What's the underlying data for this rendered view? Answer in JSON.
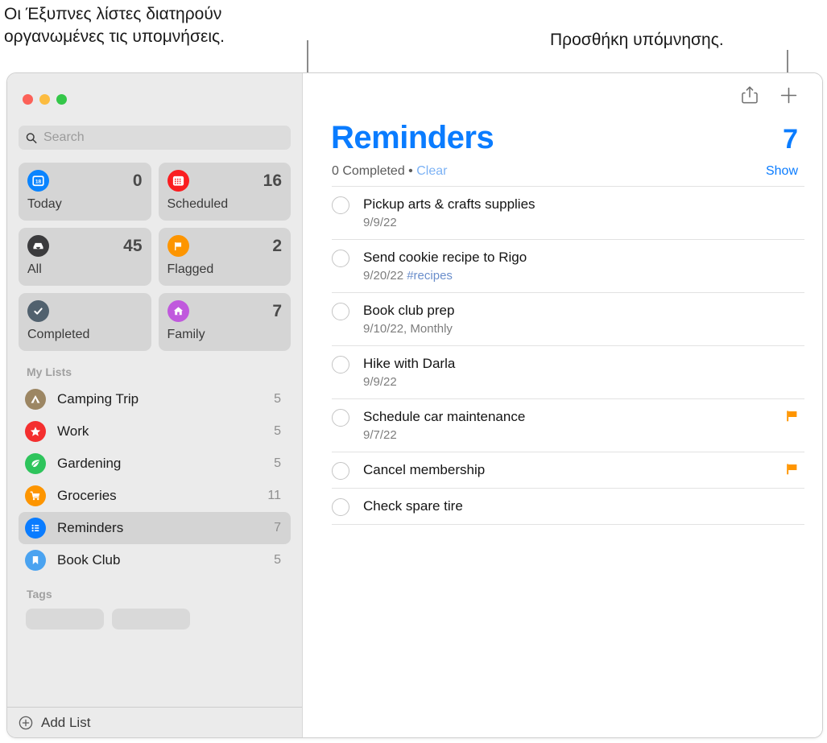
{
  "callouts": {
    "left": "Οι Έξυπνες λίστες διατηρούν\nοργανωμένες τις υπομνήσεις.",
    "right": "Προσθήκη υπόμνησης."
  },
  "window": {
    "traffic_lights": [
      {
        "name": "close",
        "color": "#fc6158"
      },
      {
        "name": "minimize",
        "color": "#fcbc40"
      },
      {
        "name": "zoom",
        "color": "#34c749"
      }
    ]
  },
  "sidebar": {
    "search": {
      "placeholder": "Search",
      "value": "",
      "icon": "search-icon"
    },
    "smart_lists": [
      {
        "label": "Today",
        "count": "0",
        "icon": "calendar-day-icon",
        "color": "#0a84ff"
      },
      {
        "label": "Scheduled",
        "count": "16",
        "icon": "calendar-grid-icon",
        "color": "#fa1d20"
      },
      {
        "label": "All",
        "count": "45",
        "icon": "inbox-tray-icon",
        "color": "#3b3b3d"
      },
      {
        "label": "Flagged",
        "count": "2",
        "icon": "flag-icon",
        "color": "#fd9500"
      },
      {
        "label": "Completed",
        "count": "",
        "icon": "checkmark-icon",
        "color": "#51616e"
      },
      {
        "label": "Family",
        "count": "7",
        "icon": "house-icon",
        "color": "#c059dd"
      }
    ],
    "my_lists_header": "My Lists",
    "lists": [
      {
        "label": "Camping Trip",
        "count": "5",
        "icon": "tent-icon",
        "color": "#9c8663",
        "selected": false
      },
      {
        "label": "Work",
        "count": "5",
        "icon": "star-icon",
        "color": "#f42f2f",
        "selected": false
      },
      {
        "label": "Gardening",
        "count": "5",
        "icon": "leaf-icon",
        "color": "#2ec45c",
        "selected": false
      },
      {
        "label": "Groceries",
        "count": "11",
        "icon": "cart-icon",
        "color": "#fd9500",
        "selected": false
      },
      {
        "label": "Reminders",
        "count": "7",
        "icon": "bullet-list-icon",
        "color": "#0a7cff",
        "selected": true
      },
      {
        "label": "Book Club",
        "count": "5",
        "icon": "bookmark-icon",
        "color": "#4aa3f0",
        "selected": false
      }
    ],
    "tags_header": "Tags",
    "tag_pills": [
      "",
      ""
    ],
    "add_list": {
      "label": "Add List",
      "icon": "plus-circle-icon"
    }
  },
  "main": {
    "toolbar": [
      {
        "name": "share-button",
        "icon": "share-icon"
      },
      {
        "name": "add-reminder-button",
        "icon": "plus-icon"
      }
    ],
    "title": "Reminders",
    "total": "7",
    "completed_text": "0 Completed",
    "separator": "•",
    "clear_label": "Clear",
    "show_label": "Show",
    "reminders": [
      {
        "title": "Pickup arts & crafts supplies",
        "date": "9/9/22",
        "extra": "",
        "tag": "",
        "flagged": false
      },
      {
        "title": "Send cookie recipe to Rigo",
        "date": "9/20/22",
        "extra": "",
        "tag": "#recipes",
        "flagged": false
      },
      {
        "title": "Book club prep",
        "date": "9/10/22,",
        "extra": "Monthly",
        "tag": "",
        "flagged": false
      },
      {
        "title": "Hike with Darla",
        "date": "9/9/22",
        "extra": "",
        "tag": "",
        "flagged": false
      },
      {
        "title": "Schedule car maintenance",
        "date": "9/7/22",
        "extra": "",
        "tag": "",
        "flagged": true
      },
      {
        "title": "Cancel membership",
        "date": "",
        "extra": "",
        "tag": "",
        "flagged": true
      },
      {
        "title": "Check spare tire",
        "date": "",
        "extra": "",
        "tag": "",
        "flagged": false
      }
    ]
  },
  "colors": {
    "accent": "#0a7cff",
    "flag": "#ff9500",
    "sidebar_bg": "#ebebeb",
    "card_bg": "#d5d5d5"
  }
}
